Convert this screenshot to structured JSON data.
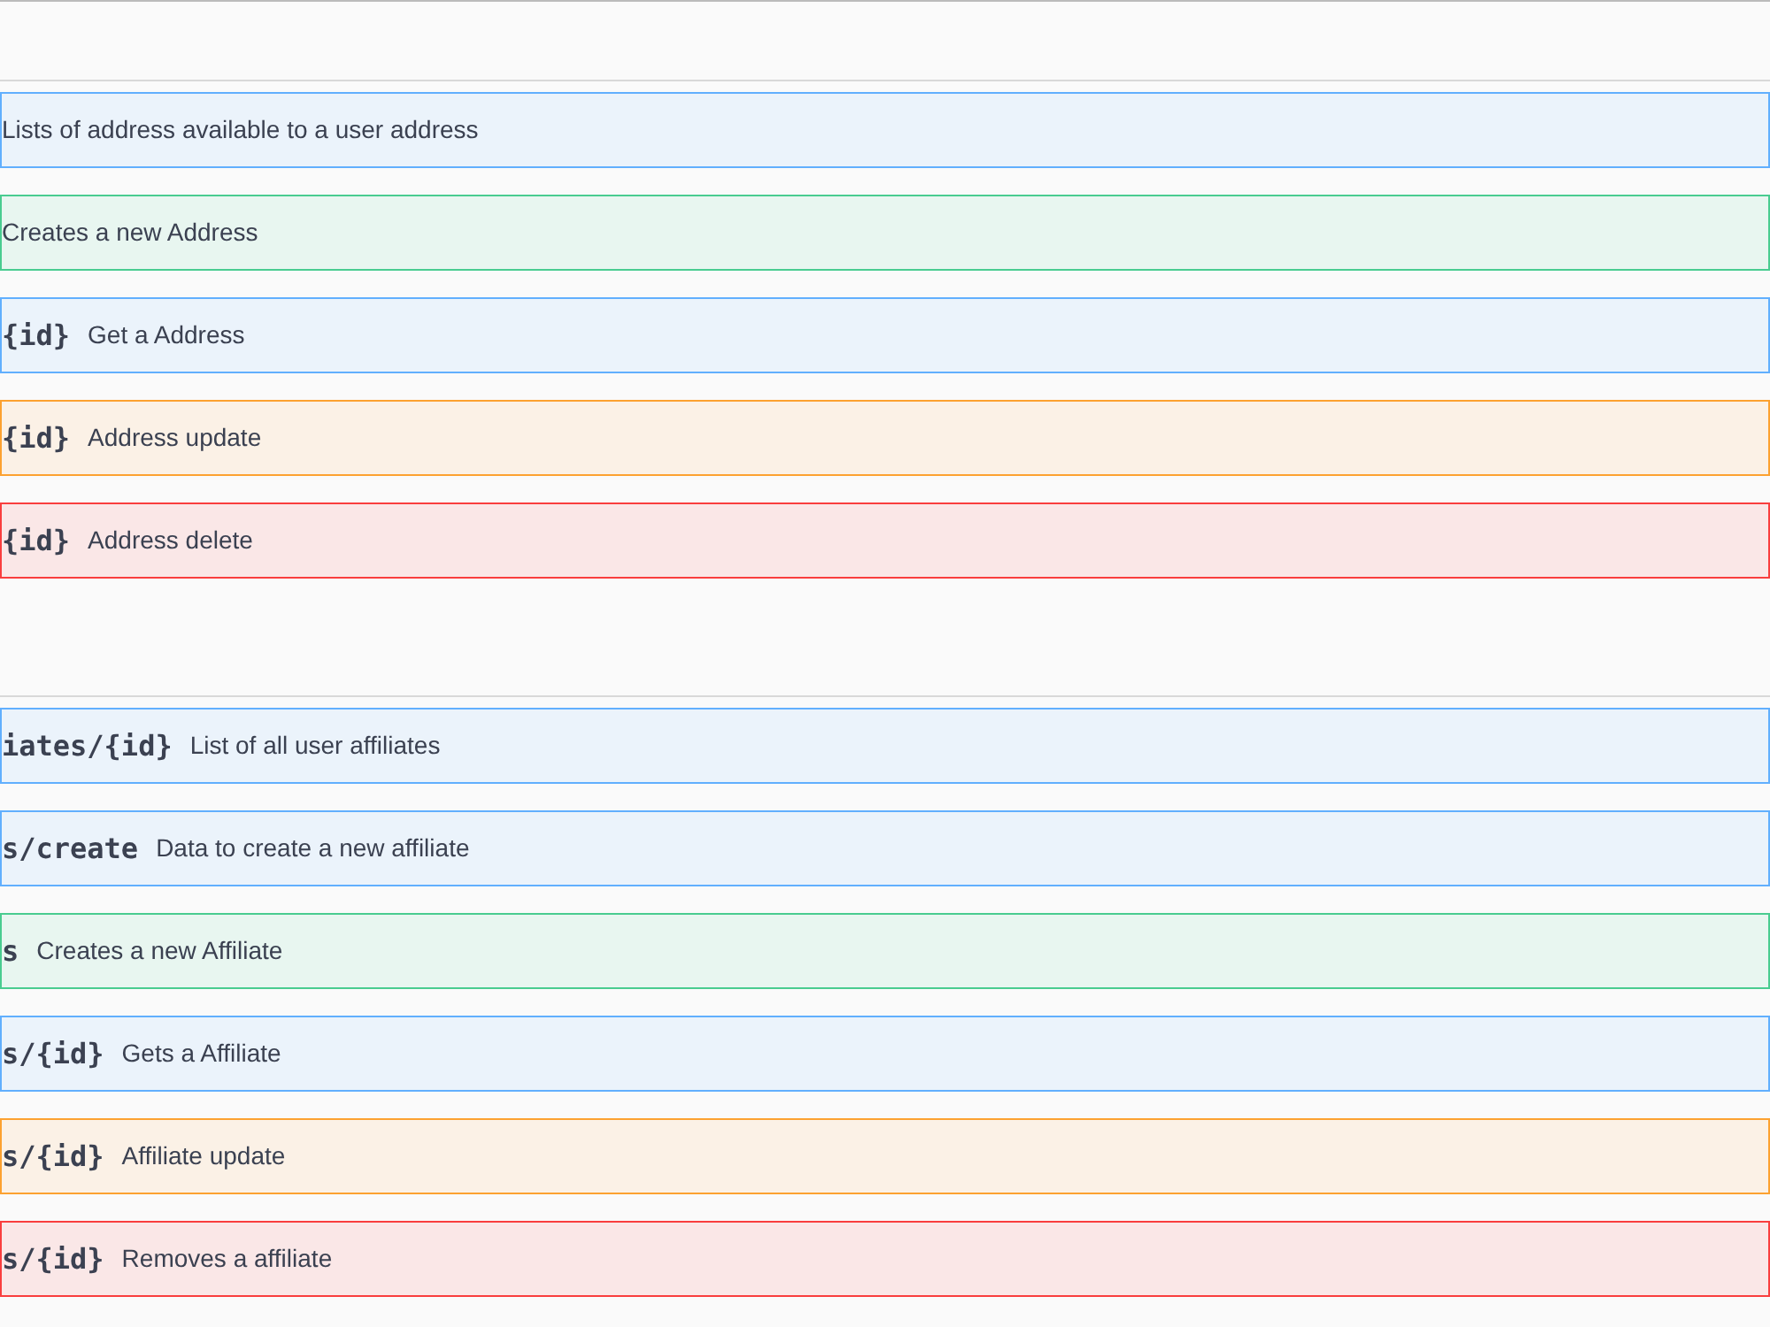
{
  "sections": [
    {
      "operations": [
        {
          "kind": "get",
          "description": "Lists of address available to a user address"
        },
        {
          "kind": "post",
          "description": "Creates a new Address"
        },
        {
          "kind": "get",
          "path": "{id}",
          "description": "Get a Address"
        },
        {
          "kind": "put",
          "path": "{id}",
          "description": "Address update"
        },
        {
          "kind": "delete",
          "path": "{id}",
          "description": "Address delete"
        }
      ]
    },
    {
      "operations": [
        {
          "kind": "get",
          "path": "iates/{id}",
          "description": "List of all user affiliates"
        },
        {
          "kind": "get",
          "path": "s/create",
          "description": "Data to create a new affiliate"
        },
        {
          "kind": "post",
          "path": "s",
          "description": "Creates a new Affiliate"
        },
        {
          "kind": "get",
          "path": "s/{id}",
          "description": "Gets a Affiliate"
        },
        {
          "kind": "put",
          "path": "s/{id}",
          "description": "Affiliate update"
        },
        {
          "kind": "delete",
          "path": "s/{id}",
          "description": "Removes a affiliate"
        }
      ]
    }
  ]
}
